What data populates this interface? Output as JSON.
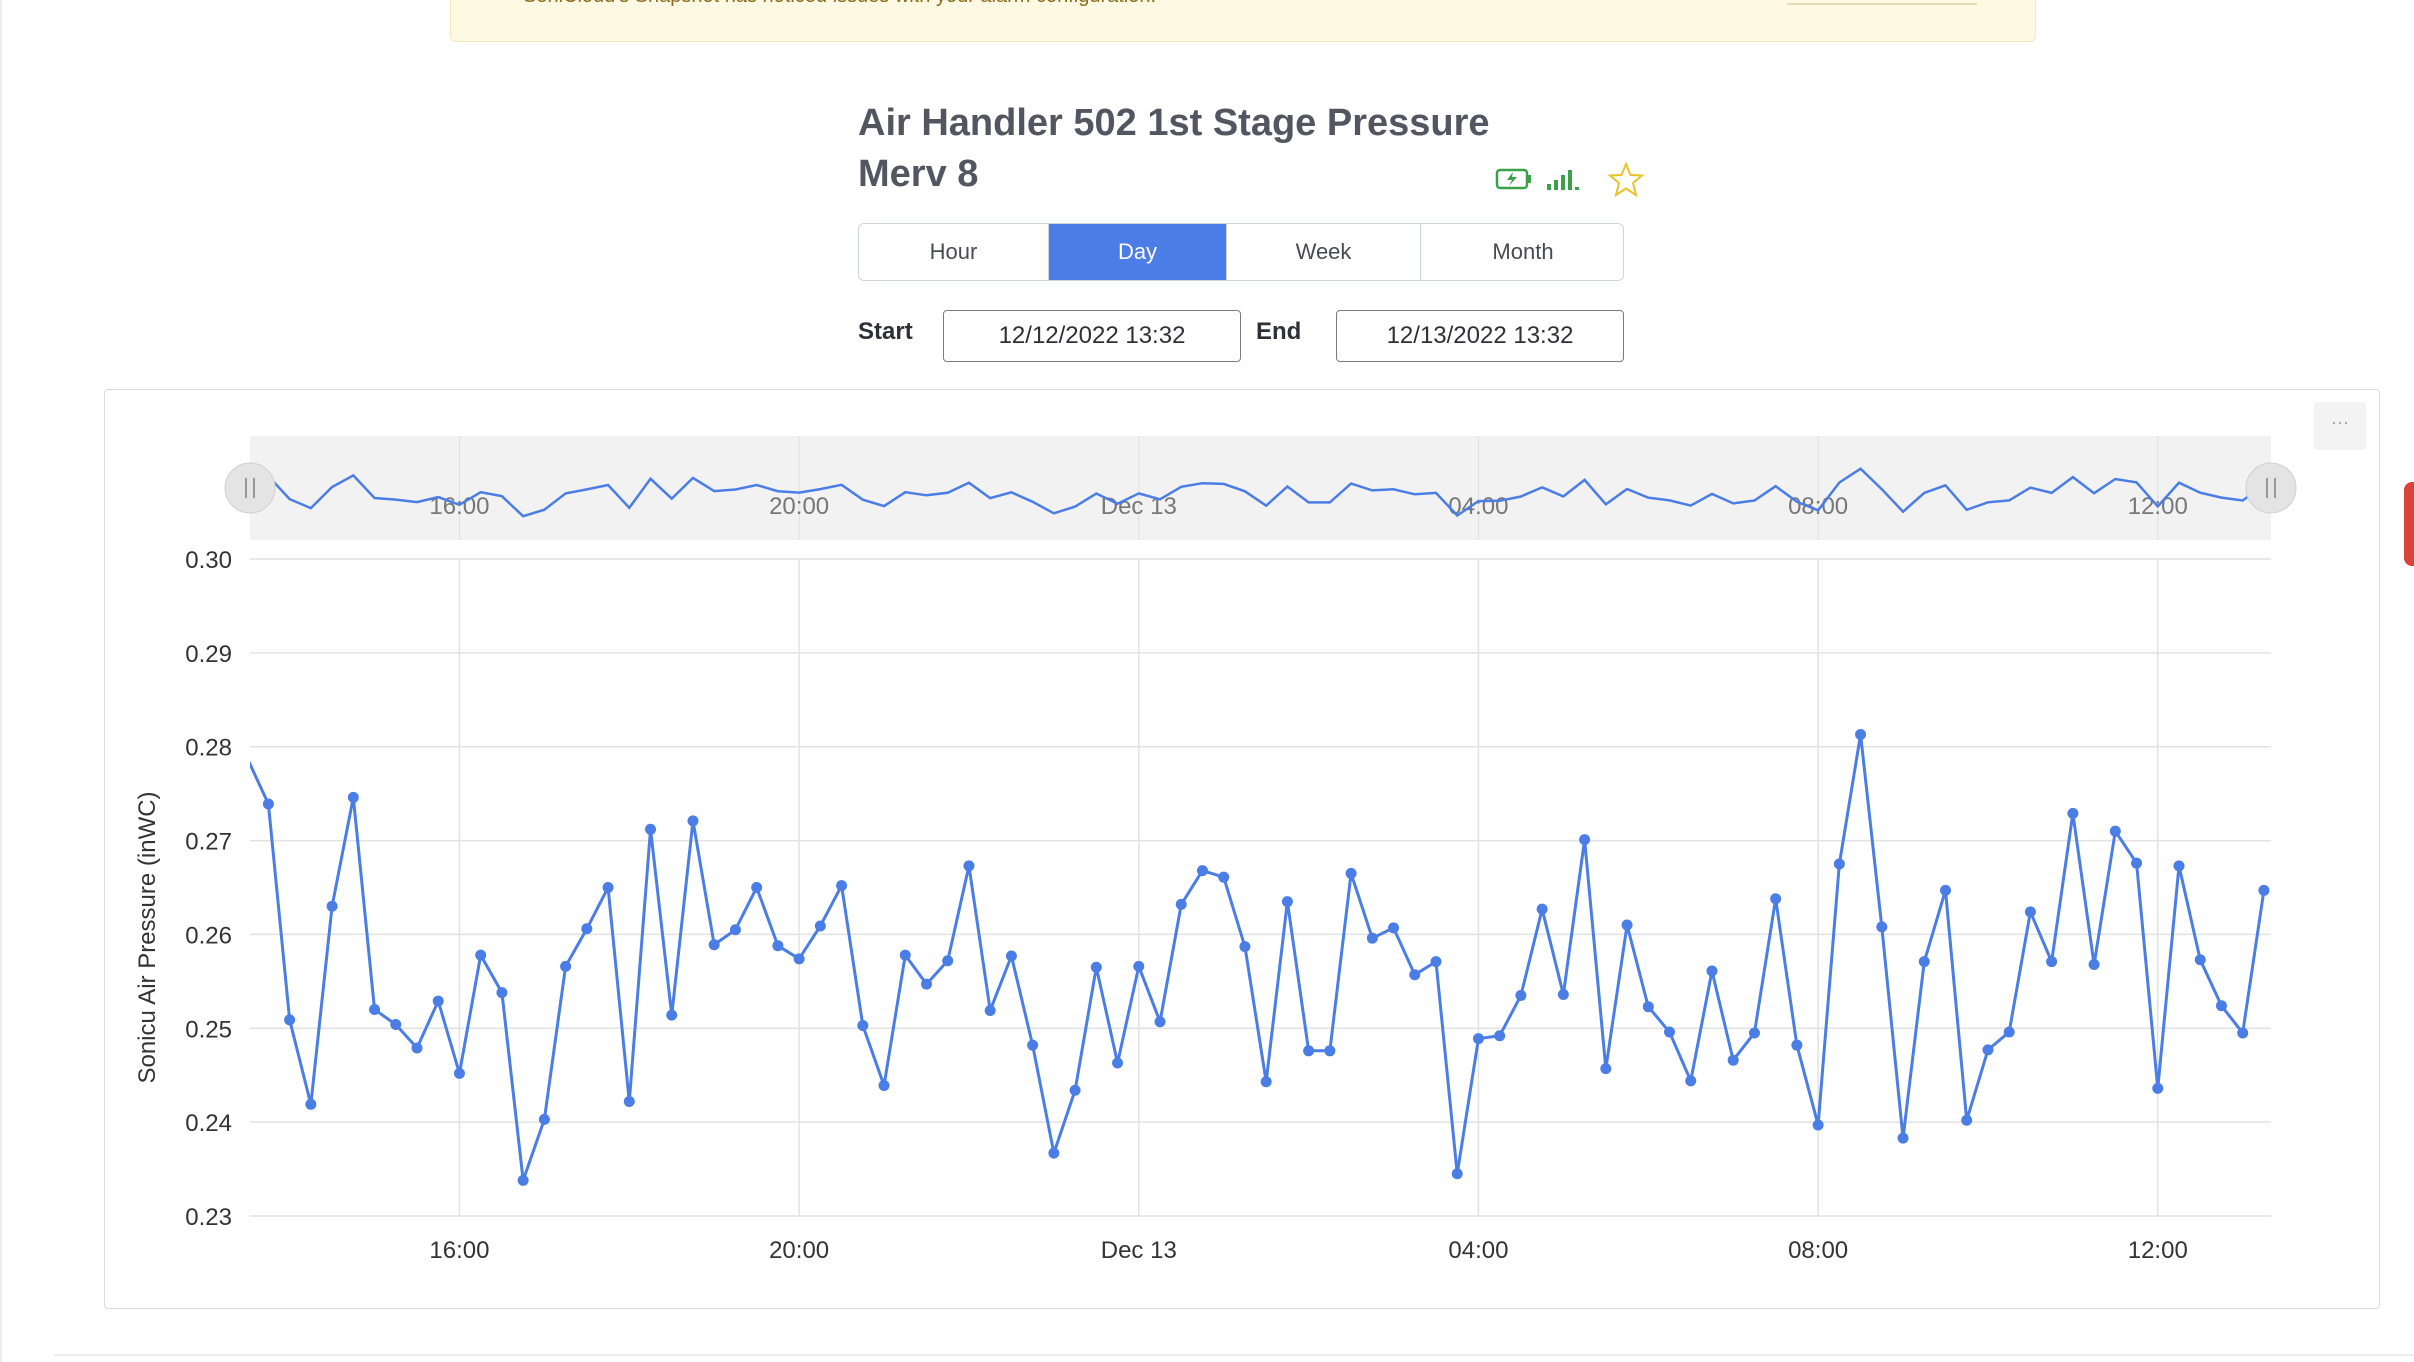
{
  "banner": {
    "text": "SoniCloud's Snapshot has noticed issues with your alarm configuration."
  },
  "header": {
    "title_line1": "Air Handler 502 1st Stage Pressure",
    "title_line2": "Merv 8"
  },
  "icons": {
    "battery": "battery-charging-icon",
    "signal": "signal-strength-icon",
    "favorite": "star-outline-icon"
  },
  "colors": {
    "accent": "#4b7de6",
    "series": "#4b7de6",
    "battery": "#3aa14a",
    "star": "#e8c42a"
  },
  "time_tabs": [
    {
      "label": "Hour",
      "active": false
    },
    {
      "label": "Day",
      "active": true
    },
    {
      "label": "Week",
      "active": false
    },
    {
      "label": "Month",
      "active": false
    }
  ],
  "range": {
    "start_label": "Start",
    "start_value": "12/12/2022 13:32",
    "end_label": "End",
    "end_value": "12/13/2022 13:32"
  },
  "chart_menu": {
    "label": "···"
  },
  "chart_data": {
    "type": "line",
    "ylabel": "Sonicu Air Pressure (inWC)",
    "ylim": [
      0.23,
      0.3
    ],
    "yticks": [
      "0.30",
      "0.29",
      "0.28",
      "0.27",
      "0.26",
      "0.25",
      "0.24",
      "0.23"
    ],
    "xlim": [
      "2022-12-12 13:32",
      "2022-12-13 13:20"
    ],
    "xticks": [
      {
        "label": "16:00",
        "at": "2022-12-12 16:00"
      },
      {
        "label": "20:00",
        "at": "2022-12-12 20:00"
      },
      {
        "label": "Dec 13",
        "at": "2022-12-13 00:00"
      },
      {
        "label": "04:00",
        "at": "2022-12-13 04:00"
      },
      {
        "label": "08:00",
        "at": "2022-12-13 08:00"
      },
      {
        "label": "12:00",
        "at": "2022-12-13 12:00"
      }
    ],
    "grid": true,
    "navigator": true,
    "series": [
      {
        "start": "2022-12-12 13:30",
        "interval_minutes": 15,
        "values": [
          0.2788,
          0.2739,
          0.2509,
          0.2419,
          0.263,
          0.2746,
          0.252,
          0.2504,
          0.2479,
          0.2529,
          0.2452,
          0.2578,
          0.2538,
          0.2338,
          0.2403,
          0.2566,
          0.2606,
          0.265,
          0.2422,
          0.2712,
          0.2514,
          0.2721,
          0.2589,
          0.2605,
          0.265,
          0.2588,
          0.2574,
          0.2609,
          0.2652,
          0.2503,
          0.2439,
          0.2578,
          0.2547,
          0.2572,
          0.2673,
          0.2519,
          0.2577,
          0.2482,
          0.2367,
          0.2434,
          0.2565,
          0.2463,
          0.2566,
          0.2507,
          0.2632,
          0.2668,
          0.2661,
          0.2587,
          0.2443,
          0.2635,
          0.2476,
          0.2476,
          0.2665,
          0.2596,
          0.2607,
          0.2557,
          0.2571,
          0.2345,
          0.2489,
          0.2492,
          0.2535,
          0.2627,
          0.2536,
          0.2701,
          0.2457,
          0.261,
          0.2523,
          0.2496,
          0.2444,
          0.2561,
          0.2466,
          0.2495,
          0.2638,
          0.2482,
          0.2397,
          0.2675,
          0.2813,
          0.2608,
          0.2383,
          0.2571,
          0.2647,
          0.2402,
          0.2477,
          0.2496,
          0.2624,
          0.2571,
          0.2729,
          0.2568,
          0.271,
          0.2676,
          0.2436,
          0.2673,
          0.2573,
          0.2524,
          0.2495,
          0.2647
        ]
      }
    ]
  }
}
